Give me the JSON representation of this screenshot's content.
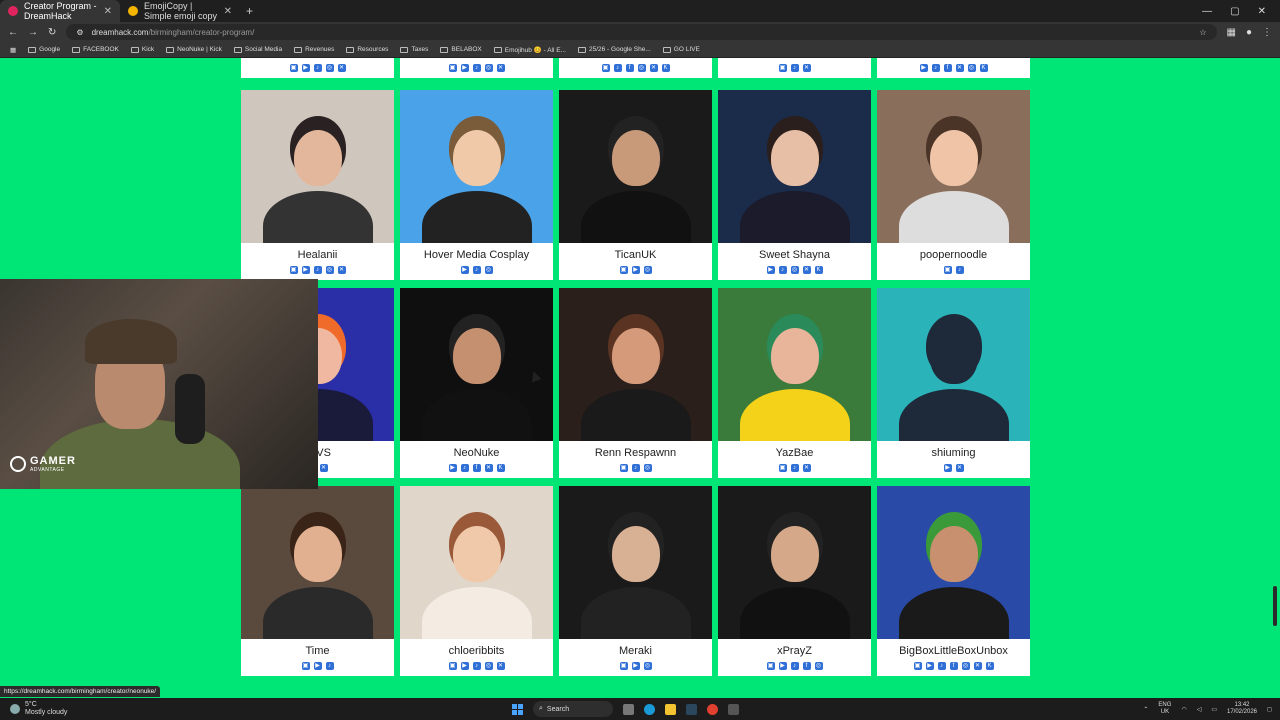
{
  "browser": {
    "tabs": [
      {
        "title": "Creator Program - DreamHack",
        "active": true,
        "color": "#e0245e"
      },
      {
        "title": "EmojiCopy | Simple emoji copy",
        "active": false,
        "color": "#f4b400"
      }
    ],
    "new_tab": "+",
    "url_host": "dreamhack.com",
    "url_path": "/birmingham/creator-program/",
    "bookmarks": [
      "Google",
      "FACEBOOK",
      "Kick",
      "NeoNuke | Kick",
      "Social Media",
      "Revenues",
      "Resources",
      "Taxes",
      "BELABOX",
      "Emojihub 😊 - All E...",
      "25/26 - Google She...",
      "GO LIVE"
    ]
  },
  "creators": {
    "row1": [
      {
        "name": "Healanii",
        "icons": [
          "tw",
          "yt",
          "tt",
          "ig",
          "x"
        ],
        "bg": "#cfc7be",
        "skin": "#e3b79c",
        "hair": "#2a2222",
        "shirt": "#333"
      },
      {
        "name": "Hover Media Cosplay",
        "icons": [
          "yt",
          "tt",
          "ig"
        ],
        "bg": "#4aa3e8",
        "skin": "#f0c9a8",
        "hair": "#7a5b3a",
        "shirt": "#222"
      },
      {
        "name": "TicanUK",
        "icons": [
          "tw",
          "yt",
          "ig"
        ],
        "bg": "#1a1a1a",
        "skin": "#c99a7a",
        "hair": "#222",
        "shirt": "#111"
      },
      {
        "name": "Sweet Shayna",
        "icons": [
          "yt",
          "tt",
          "ig",
          "x",
          "k"
        ],
        "bg": "#1b2b4a",
        "skin": "#e7bfa6",
        "hair": "#2a1f1c",
        "shirt": "#1b1b2b"
      },
      {
        "name": "poopernoodle",
        "icons": [
          "tw",
          "tt"
        ],
        "bg": "#8a6e5c",
        "skin": "#f0c4a6",
        "hair": "#4a3327",
        "shirt": "#ddd"
      }
    ],
    "row2": [
      {
        "name": "ehVS",
        "icons": [
          "ig",
          "x"
        ],
        "bg": "#2a2fa8",
        "skin": "#f0b8a0",
        "hair": "#f06a2a",
        "shirt": "#1a1a3a"
      },
      {
        "name": "NeoNuke",
        "icons": [
          "yt",
          "tt",
          "fb",
          "x",
          "k"
        ],
        "bg": "#0f0f0f",
        "skin": "#c49070",
        "hair": "#222",
        "shirt": "#111"
      },
      {
        "name": "Renn Respawnn",
        "icons": [
          "tw",
          "tt",
          "ig"
        ],
        "bg": "#2a1f1a",
        "skin": "#d49a7a",
        "hair": "#5a3322",
        "shirt": "#1a1a1a"
      },
      {
        "name": "YazBae",
        "icons": [
          "tw",
          "tt",
          "x"
        ],
        "bg": "#3a7a3a",
        "skin": "#e8b49a",
        "hair": "#2a8a5a",
        "shirt": "#f5d21a"
      },
      {
        "name": "shiuming",
        "icons": [
          "yt",
          "x"
        ],
        "bg": "#2ab3b8",
        "skin": "#1e2a3a",
        "hair": "#1e2a3a",
        "shirt": "#1e2a3a"
      }
    ],
    "row3": [
      {
        "name": "Time",
        "icons": [
          "tw",
          "yt",
          "tt"
        ],
        "bg": "#5a4a3e",
        "skin": "#e0b090",
        "hair": "#3a2418",
        "shirt": "#2a2a2a"
      },
      {
        "name": "chloeribbits",
        "icons": [
          "tw",
          "yt",
          "tt",
          "ig",
          "x"
        ],
        "bg": "#e0d6ca",
        "skin": "#f0c8aa",
        "hair": "#9a5a3a",
        "shirt": "#f4ece2"
      },
      {
        "name": "Meraki",
        "icons": [
          "tw",
          "yt",
          "ig"
        ],
        "bg": "#1a1a1a",
        "skin": "#d8b094",
        "hair": "#222",
        "shirt": "#222"
      },
      {
        "name": "xPrayZ",
        "icons": [
          "tw",
          "yt",
          "tt",
          "fb",
          "ig"
        ],
        "bg": "#1a1a1a",
        "skin": "#d4a888",
        "hair": "#222",
        "shirt": "#111"
      },
      {
        "name": "BigBoxLittleBoxUnbox",
        "icons": [
          "tw",
          "yt",
          "tt",
          "fb",
          "ig",
          "x",
          "k"
        ],
        "bg": "#2a4aa8",
        "skin": "#c99070",
        "hair": "#3a9a3a",
        "shirt": "#1a1a1a"
      }
    ]
  },
  "webcam": {
    "brand": "GAMER",
    "tagline": "ADVANTAGE"
  },
  "status_link": "https://dreamhack.com/birmingham/creator/neonuke/",
  "taskbar": {
    "temp": "5°C",
    "weather": "Mostly cloudy",
    "search_placeholder": "Search",
    "lang_top": "ENG",
    "lang_bottom": "UK",
    "time": "13:42",
    "date": "17/02/2026"
  },
  "icon_glyphs": {
    "tw": "▣",
    "yt": "▶",
    "tt": "♪",
    "ig": "◎",
    "x": "✕",
    "fb": "f",
    "k": "K"
  },
  "icon_colors": {
    "tw": "#2f6fd6",
    "yt": "#2f6fd6",
    "tt": "#2f6fd6",
    "ig": "#2f6fd6",
    "x": "#2f6fd6",
    "fb": "#2f6fd6",
    "k": "#2f6fd6"
  },
  "accent": "#00e676"
}
